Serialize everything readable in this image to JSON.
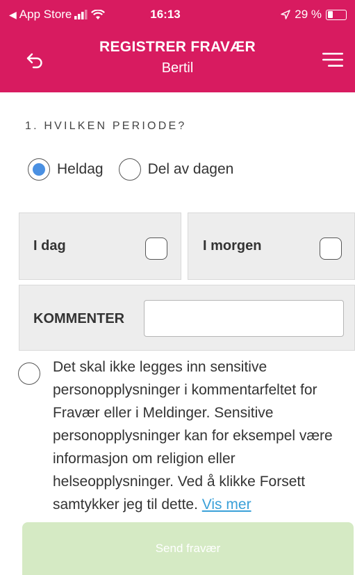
{
  "status_bar": {
    "carrier": "App Store",
    "back_arrow": "◀",
    "time": "16:13",
    "battery": "29 %",
    "battery_level": 0.29
  },
  "header": {
    "title": "REGISTRER FRAVÆR",
    "subtitle": "Bertil",
    "back_icon": "back-arrow-icon",
    "menu_icon": "hamburger-menu-icon"
  },
  "section": {
    "heading": "1. HVILKEN PERIODE?"
  },
  "period": {
    "options": [
      {
        "label": "Heldag",
        "selected": true
      },
      {
        "label": "Del av dagen",
        "selected": false
      }
    ]
  },
  "days": {
    "today_label": "I dag",
    "tomorrow_label": "I morgen"
  },
  "comment": {
    "label": "KOMMENTER",
    "value": "",
    "placeholder": ""
  },
  "consent": {
    "text": "Det skal ikke legges inn sensitive personopplysninger i kommentarfeltet for Fravær eller i Meldinger. Sensitive personopplysninger kan for eksempel være informasjon om religion eller helseopplysninger. Ved å klikke Forsett samtykker jeg til dette.",
    "link": "Vis mer"
  },
  "submit": {
    "label": "Send fravær"
  },
  "colors": {
    "brand": "#d81b60",
    "radio_selected": "#4a90e2",
    "link": "#3aa0d8",
    "submit_disabled": "#d5eac4",
    "box_bg": "#ededed"
  }
}
